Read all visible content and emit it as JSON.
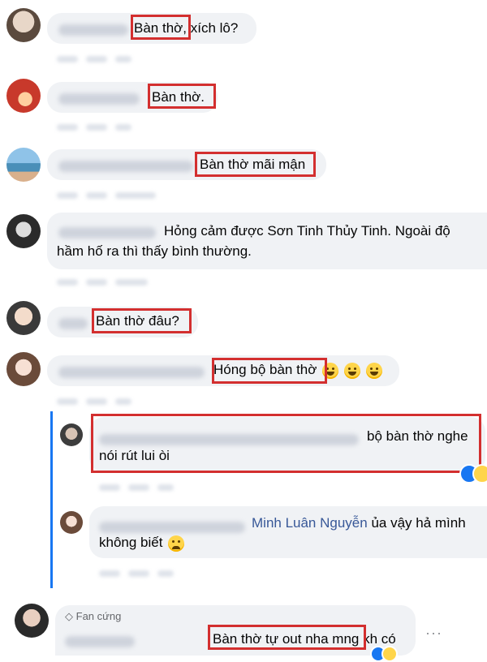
{
  "comments": [
    {
      "text": "Bàn thờ, xích lô?"
    },
    {
      "text": "Bàn thờ."
    },
    {
      "text": "Bàn thờ mãi mận"
    },
    {
      "line1": "Hỏng cảm được Sơn Tinh Thủy Tinh. Ngoài độ",
      "line2": "hầm hố ra thì thấy bình thường."
    },
    {
      "text": "Bàn thờ đâu?"
    },
    {
      "text": "Hóng bộ bàn thờ",
      "emojis": [
        "sweat-smile-emoji",
        "sweat-smile-emoji",
        "sweat-smile-emoji"
      ]
    }
  ],
  "replies": [
    {
      "line1": "bộ bàn thờ nghe",
      "line2": "nói rút lui òi"
    },
    {
      "mention": "Minh Luân Nguyễn",
      "line1_rest": " ủa vậy hả mình",
      "line2": "không biết"
    }
  ],
  "last_comment": {
    "badge": "Fan cứng",
    "text": "Bàn thờ tự out nha mng kh có"
  },
  "colors": {
    "highlight": "#d32f2f",
    "thread": "#1877f2",
    "bubble": "#f0f2f5",
    "mention": "#385898"
  }
}
